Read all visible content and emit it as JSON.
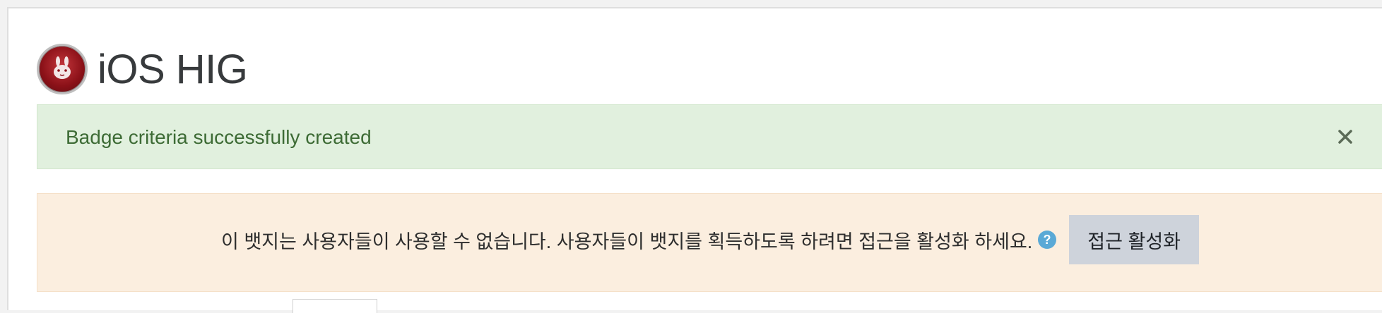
{
  "header": {
    "badge_icon": "badge-rabbit-icon",
    "title": "iOS HIG"
  },
  "alerts": {
    "success": {
      "message": "Badge criteria successfully created",
      "close_icon": "close-icon"
    },
    "warning": {
      "message": "이 뱃지는 사용자들이 사용할 수 없습니다. 사용자들이 뱃지를 획득하도록 하려면 접근을 활성화 하세요.",
      "help_icon": "help-icon",
      "button_label": "접근 활성화"
    }
  },
  "colors": {
    "success_bg": "#e1f0de",
    "success_text": "#3d6b35",
    "warning_bg": "#fbeedf",
    "button_bg": "#ced3db",
    "help_icon": "#5aa9d6"
  }
}
